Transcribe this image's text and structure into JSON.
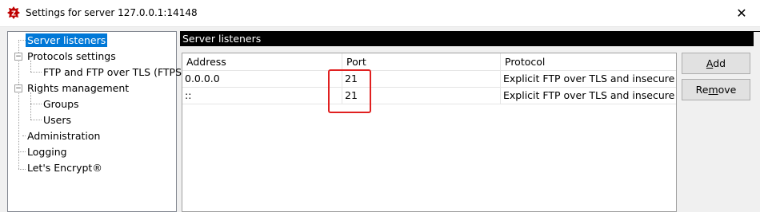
{
  "window": {
    "title": "Settings for server 127.0.0.1:14148",
    "close_glyph": "✕",
    "app_icon": "filezilla-server-icon",
    "app_icon_letter": "Z",
    "app_icon_color": "#bf0000"
  },
  "tree": {
    "items": [
      {
        "label": "Server listeners",
        "selected": true
      },
      {
        "label": "Protocols settings",
        "expanded": true
      },
      {
        "label": "FTP and FTP over TLS (FTPS)"
      },
      {
        "label": "Rights management",
        "expanded": true
      },
      {
        "label": "Groups"
      },
      {
        "label": "Users"
      },
      {
        "label": "Administration"
      },
      {
        "label": "Logging"
      },
      {
        "label": "Let's Encrypt®"
      }
    ],
    "expander_glyph": "−"
  },
  "section": {
    "title": "Server listeners"
  },
  "listeners": {
    "columns": [
      "Address",
      "Port",
      "Protocol"
    ],
    "rows": [
      {
        "address": "0.0.0.0",
        "port": "21",
        "protocol": "Explicit FTP over TLS and insecure pla"
      },
      {
        "address": "::",
        "port": "21",
        "protocol": "Explicit FTP over TLS and insecure pla"
      }
    ]
  },
  "buttons": {
    "add": "Add",
    "add_underline": "A",
    "remove": "Remove",
    "remove_underline": "m"
  },
  "colors": {
    "selection": "#0078d7",
    "header_bg": "#000000",
    "highlight": "#e02020"
  }
}
